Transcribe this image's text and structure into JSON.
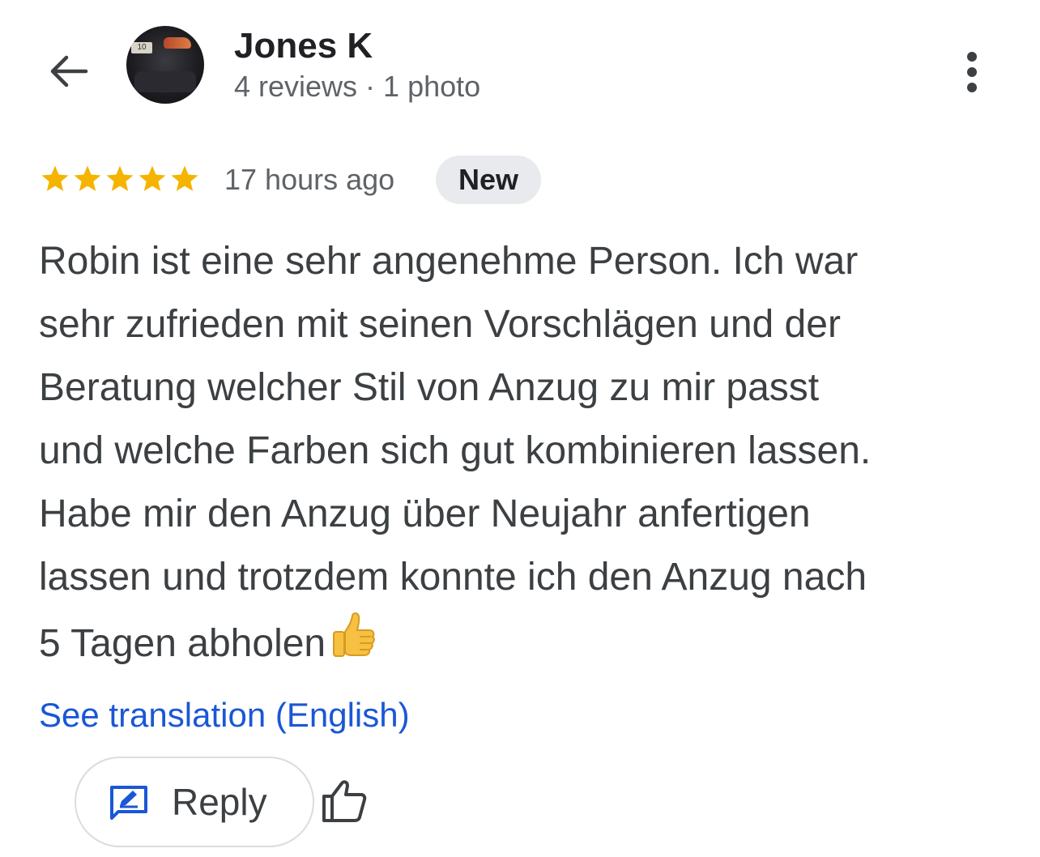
{
  "header": {
    "back_icon": "arrow-left-icon",
    "user_name": "Jones K",
    "user_meta": "4 reviews · 1 photo",
    "avatar_plate_text": "10",
    "menu_icon": "more-vert-icon"
  },
  "review": {
    "rating": 5,
    "rating_max": 5,
    "star_color": "#f4b400",
    "time_ago": "17 hours ago",
    "badge": "New",
    "lines": [
      "Robin ist eine sehr angenehme Person. Ich war",
      "sehr zufrieden mit seinen Vorschlägen und der",
      "Beratung welcher Stil von Anzug zu mir passt",
      "und welche Farben sich gut kombinieren lassen.",
      "Habe mir den Anzug über Neujahr anfertigen",
      "lassen und trotzdem konnte ich den Anzug nach",
      "5 Tagen abholen"
    ],
    "emoji_icon": "thumbs-up-emoji-icon"
  },
  "actions": {
    "translate_link": "See translation (English)",
    "link_color": "#1a57d6",
    "reply_label": "Reply",
    "reply_icon": "rate-review-icon",
    "like_icon": "thumb-up-outline-icon"
  }
}
